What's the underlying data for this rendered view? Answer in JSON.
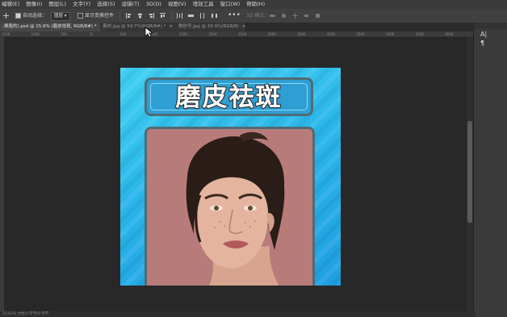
{
  "menu": {
    "items": [
      "编辑(E)",
      "图像(I)",
      "图层(L)",
      "文字(Y)",
      "选择(S)",
      "滤镜(T)",
      "3D(D)",
      "视图(V)",
      "增效工具",
      "窗口(W)",
      "帮助(H)"
    ]
  },
  "options": {
    "auto_select_label": "自动选择：",
    "auto_select_value": "图层",
    "show_transform_label": "显示变换控件",
    "mode_3d_label": "3D 模式："
  },
  "tabs": [
    {
      "label": "-换脸的).psd @ 15.6% (磨皮祛斑, RGB/8#) *",
      "close": "×"
    },
    {
      "label": "素材.jpg @ 54.7%(RGB/8#) *",
      "close": "×"
    },
    {
      "label": "微信号.jpg @ 34.9%(RGB/8)",
      "close": "×"
    }
  ],
  "ruler": {
    "ticks": [
      "1500",
      "1000",
      "500",
      "0",
      "500",
      "1000",
      "1500",
      "2000",
      "2500",
      "3000",
      "3500",
      "4000",
      "4500",
      "5000",
      "5500",
      "6000"
    ]
  },
  "status": {
    "text": "15.61%   文档:0 字节/0 字节"
  },
  "document": {
    "title_text": "磨皮祛斑"
  },
  "panel": {
    "icons": [
      "character-icon",
      "paragraph-icon"
    ]
  },
  "colors": {
    "accent": "#2ab6ea",
    "frame": "#4f6c73",
    "photo_bg": "#b77c7a"
  }
}
